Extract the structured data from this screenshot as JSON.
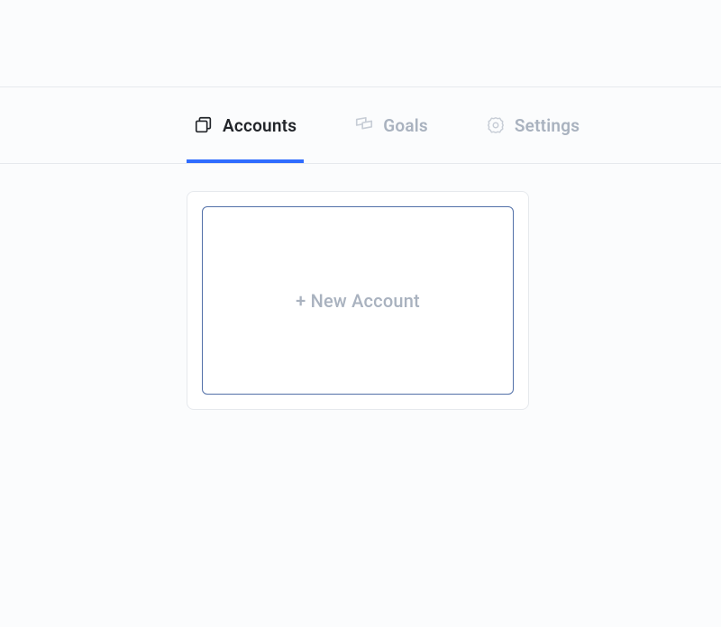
{
  "tabs": {
    "accounts": {
      "label": "Accounts"
    },
    "goals": {
      "label": "Goals"
    },
    "settings": {
      "label": "Settings"
    }
  },
  "card": {
    "new_account_label": "+ New Account"
  }
}
